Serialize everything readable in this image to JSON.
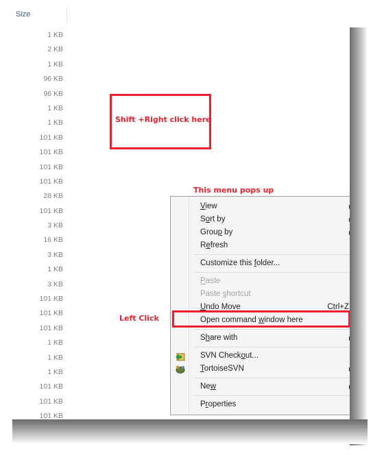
{
  "column_header": "Size",
  "sizes": [
    "1 KB",
    "2 KB",
    "1 KB",
    "96 KB",
    "96 KB",
    "1 KB",
    "1 KB",
    "101 KB",
    "101 KB",
    "101 KB",
    "101 KB",
    "28 KB",
    "101 KB",
    "3 KB",
    "16 KB",
    "3 KB",
    "1 KB",
    "3 KB",
    "101 KB",
    "101 KB",
    "101 KB",
    "1 KB",
    "1 KB",
    "1 KB",
    "101 KB",
    "101 KB",
    "101 KB"
  ],
  "annotations": {
    "right_click": "Shift +Right click here",
    "menu_pops": "This menu pops up",
    "left_click": "Left Click",
    "color": "#e8212d"
  },
  "menu": {
    "view": {
      "pre": "",
      "ul": "V",
      "post": "iew"
    },
    "sort_by": {
      "pre": "S",
      "ul": "o",
      "post": "rt by"
    },
    "group_by": {
      "pre": "Grou",
      "ul": "p",
      "post": " by"
    },
    "refresh": {
      "pre": "R",
      "ul": "e",
      "post": "fresh"
    },
    "customize": {
      "pre": "Customize this ",
      "ul": "f",
      "post": "older..."
    },
    "paste": {
      "pre": "",
      "ul": "P",
      "post": "aste"
    },
    "paste_shortcut": {
      "pre": "Paste ",
      "ul": "s",
      "post": "hortcut"
    },
    "undo_move": {
      "pre": "",
      "ul": "U",
      "post": "ndo Move"
    },
    "undo_shortcut": "Ctrl+Z",
    "open_cmd": {
      "pre": "Open command ",
      "ul": "w",
      "post": "indow here"
    },
    "share_with": {
      "pre": "S",
      "ul": "h",
      "post": "are with"
    },
    "svn_checkout": {
      "pre": "SVN Check",
      "ul": "o",
      "post": "ut..."
    },
    "tortoise": {
      "pre": "",
      "ul": "T",
      "post": "ortoiseSVN"
    },
    "new": {
      "pre": "Ne",
      "ul": "w",
      "post": ""
    },
    "properties": {
      "pre": "P",
      "ul": "r",
      "post": "operties"
    }
  }
}
